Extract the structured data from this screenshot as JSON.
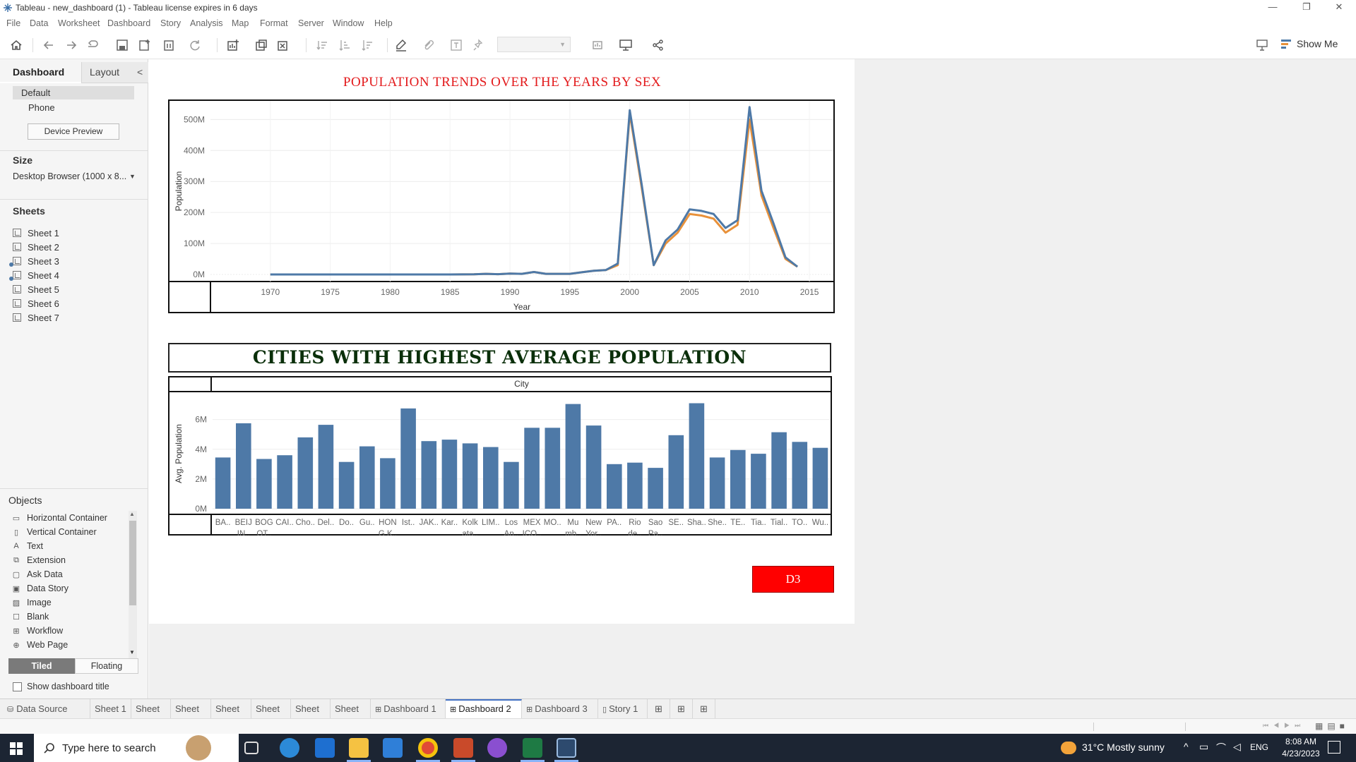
{
  "window": {
    "title": "Tableau - new_dashboard (1) - Tableau license expires in 6 days",
    "controls": [
      "—",
      "❐",
      "✕"
    ]
  },
  "menu": [
    "File",
    "Data",
    "Worksheet",
    "Dashboard",
    "Story",
    "Analysis",
    "Map",
    "Format",
    "Server",
    "Window",
    "Help"
  ],
  "toolbar": {
    "show_me": "Show Me"
  },
  "left_panel": {
    "tabs": [
      "Dashboard",
      "Layout"
    ],
    "collapse": "<",
    "devices": [
      "Default",
      "Phone"
    ],
    "device_preview": "Device Preview",
    "size_heading": "Size",
    "size_value": "Desktop Browser (1000 x 8...",
    "sheets_heading": "Sheets",
    "sheets": [
      "Sheet 1",
      "Sheet 2",
      "Sheet 3",
      "Sheet 4",
      "Sheet 5",
      "Sheet 6",
      "Sheet 7"
    ],
    "objects_heading": "Objects",
    "objects": [
      {
        "label": "Horizontal Container",
        "icon": "horizontal-container-icon",
        "glyph": "▭"
      },
      {
        "label": "Vertical Container",
        "icon": "vertical-container-icon",
        "glyph": "▯"
      },
      {
        "label": "Text",
        "icon": "text-icon",
        "glyph": "A"
      },
      {
        "label": "Extension",
        "icon": "extension-icon",
        "glyph": "⧉"
      },
      {
        "label": "Ask Data",
        "icon": "ask-data-icon",
        "glyph": "▢"
      },
      {
        "label": "Data Story",
        "icon": "data-story-icon",
        "glyph": "▣"
      },
      {
        "label": "Image",
        "icon": "image-icon",
        "glyph": "▨"
      },
      {
        "label": "Blank",
        "icon": "blank-icon",
        "glyph": "☐"
      },
      {
        "label": "Workflow",
        "icon": "workflow-icon",
        "glyph": "⊞"
      },
      {
        "label": "Web Page",
        "icon": "web-page-icon",
        "glyph": "⊕"
      }
    ],
    "tiled": "Tiled",
    "floating": "Floating",
    "show_title": "Show dashboard title"
  },
  "dashboard": {
    "line_title": "POPULATION TRENDS OVER THE YEARS BY SEX",
    "bar_title": "CITIES WITH HIGHEST AVERAGE POPULATION",
    "bar_header": "City",
    "button": "D3"
  },
  "chart_data": [
    {
      "type": "line",
      "xlabel": "Year",
      "ylabel": "Population",
      "xlim": [
        1965,
        2017
      ],
      "ylim": [
        0,
        560000000
      ],
      "x_ticks": [
        1970,
        1975,
        1980,
        1985,
        1990,
        1995,
        2000,
        2005,
        2010,
        2015
      ],
      "y_ticks": [
        0,
        100000000,
        200000000,
        300000000,
        400000000,
        500000000
      ],
      "y_tick_labels": [
        "0M",
        "100M",
        "200M",
        "300M",
        "400M",
        "500M"
      ],
      "grid": true,
      "x": [
        1970,
        1975,
        1980,
        1985,
        1987,
        1988,
        1989,
        1990,
        1991,
        1992,
        1993,
        1994,
        1995,
        1996,
        1997,
        1998,
        1999,
        2000,
        2001,
        2002,
        2003,
        2004,
        2005,
        2006,
        2007,
        2008,
        2009,
        2010,
        2011,
        2012,
        2013,
        2014
      ],
      "series": [
        {
          "color": "#e8913a",
          "values": [
            0,
            0,
            0,
            0,
            500000,
            2000000,
            1000000,
            3000000,
            2000000,
            8000000,
            2000000,
            2000000,
            2000000,
            7000000,
            12000000,
            14000000,
            30000000,
            520000000,
            280000000,
            30000000,
            100000000,
            135000000,
            195000000,
            190000000,
            180000000,
            135000000,
            160000000,
            500000000,
            255000000,
            150000000,
            50000000,
            25000000
          ]
        },
        {
          "color": "#4e79a7",
          "values": [
            0,
            0,
            0,
            0,
            500000,
            2000000,
            1000000,
            3000000,
            2000000,
            8000000,
            2000000,
            2000000,
            2000000,
            7000000,
            12000000,
            14000000,
            35000000,
            530000000,
            290000000,
            30000000,
            110000000,
            145000000,
            210000000,
            205000000,
            195000000,
            150000000,
            175000000,
            540000000,
            270000000,
            165000000,
            55000000,
            25000000
          ]
        }
      ]
    },
    {
      "type": "bar",
      "header": "City",
      "ylabel": "Avg. Population",
      "ylim": [
        0,
        7600000
      ],
      "y_ticks": [
        0,
        2000000,
        4000000,
        6000000
      ],
      "y_tick_labels": [
        "0M",
        "2M",
        "4M",
        "6M"
      ],
      "bar_color": "#4e79a7",
      "categories": [
        [
          "BA.."
        ],
        [
          "BEIJ",
          "IN.."
        ],
        [
          "BOG",
          "OT.."
        ],
        [
          "CAI.."
        ],
        [
          "Cho.."
        ],
        [
          "Del.."
        ],
        [
          "Do.."
        ],
        [
          "Gu.."
        ],
        [
          "HON",
          "G K.."
        ],
        [
          "Ist.."
        ],
        [
          "JAK.."
        ],
        [
          "Kar.."
        ],
        [
          "Kolk",
          "ata.."
        ],
        [
          "LIM.."
        ],
        [
          "Los",
          "An.."
        ],
        [
          "MEX",
          "ICO.."
        ],
        [
          "MO.."
        ],
        [
          "Mu",
          "mb.."
        ],
        [
          "New",
          "Yor.."
        ],
        [
          "PA.."
        ],
        [
          "Rio",
          "de.."
        ],
        [
          "Sao",
          "Pa.."
        ],
        [
          "SE.."
        ],
        [
          "Sha.."
        ],
        [
          "She.."
        ],
        [
          "TE.."
        ],
        [
          "Tia.."
        ],
        [
          "Tial.."
        ],
        [
          "TO.."
        ],
        [
          "Wu.."
        ]
      ],
      "values": [
        3450000,
        5750000,
        3350000,
        3600000,
        4800000,
        5650000,
        3150000,
        4200000,
        3400000,
        6750000,
        4550000,
        4650000,
        4400000,
        4150000,
        3150000,
        5450000,
        5450000,
        7050000,
        5600000,
        3000000,
        3100000,
        2750000,
        4950000,
        7100000,
        3450000,
        3950000,
        3700000,
        5150000,
        4500000,
        4100000
      ]
    }
  ],
  "tabs": {
    "data_source": "Data Source",
    "items": [
      "Sheet 1",
      "Sheet 2",
      "Sheet 3",
      "Sheet 4",
      "Sheet 5",
      "Sheet 6",
      "Sheet 7",
      "Dashboard 1",
      "Dashboard 2",
      "Dashboard 3",
      "Story 1"
    ],
    "active": "Dashboard 2"
  },
  "taskbar": {
    "search_placeholder": "Type here to search",
    "weather": "31°C  Mostly sunny",
    "language": "ENG",
    "time": "8:08 AM",
    "date": "4/23/2023"
  }
}
